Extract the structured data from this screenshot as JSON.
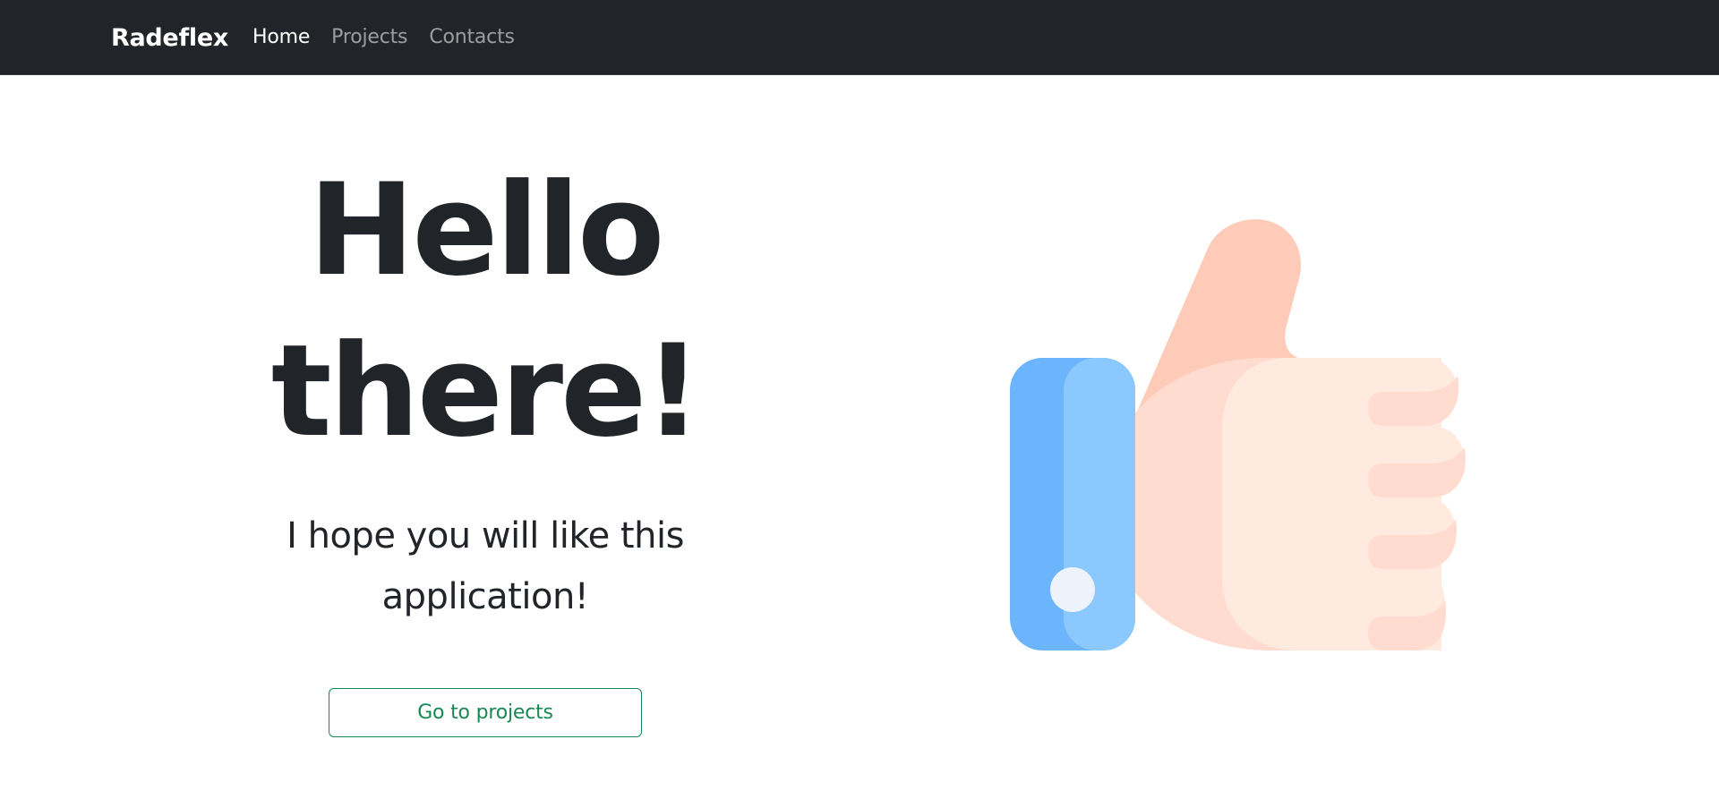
{
  "navbar": {
    "brand": "Radeflex",
    "links": [
      {
        "label": "Home",
        "active": true
      },
      {
        "label": "Projects",
        "active": false
      },
      {
        "label": "Contacts",
        "active": false
      }
    ]
  },
  "hero": {
    "title_line1": "Hello",
    "title_line2": "there!",
    "subtitle_line1": "I hope you will like this",
    "subtitle_line2": "application!",
    "cta_label": "Go to projects"
  },
  "illustration": {
    "icon": "thumbs-up-icon"
  },
  "colors": {
    "navbar_bg": "#212529",
    "text": "#212529",
    "accent_green": "#198754",
    "cuff_blue_dark": "#6cb4fb",
    "cuff_blue_light": "#8bc8fd",
    "skin_dark": "#fecbb9",
    "skin_mid": "#ffdccf",
    "skin_light": "#ffeae0"
  }
}
